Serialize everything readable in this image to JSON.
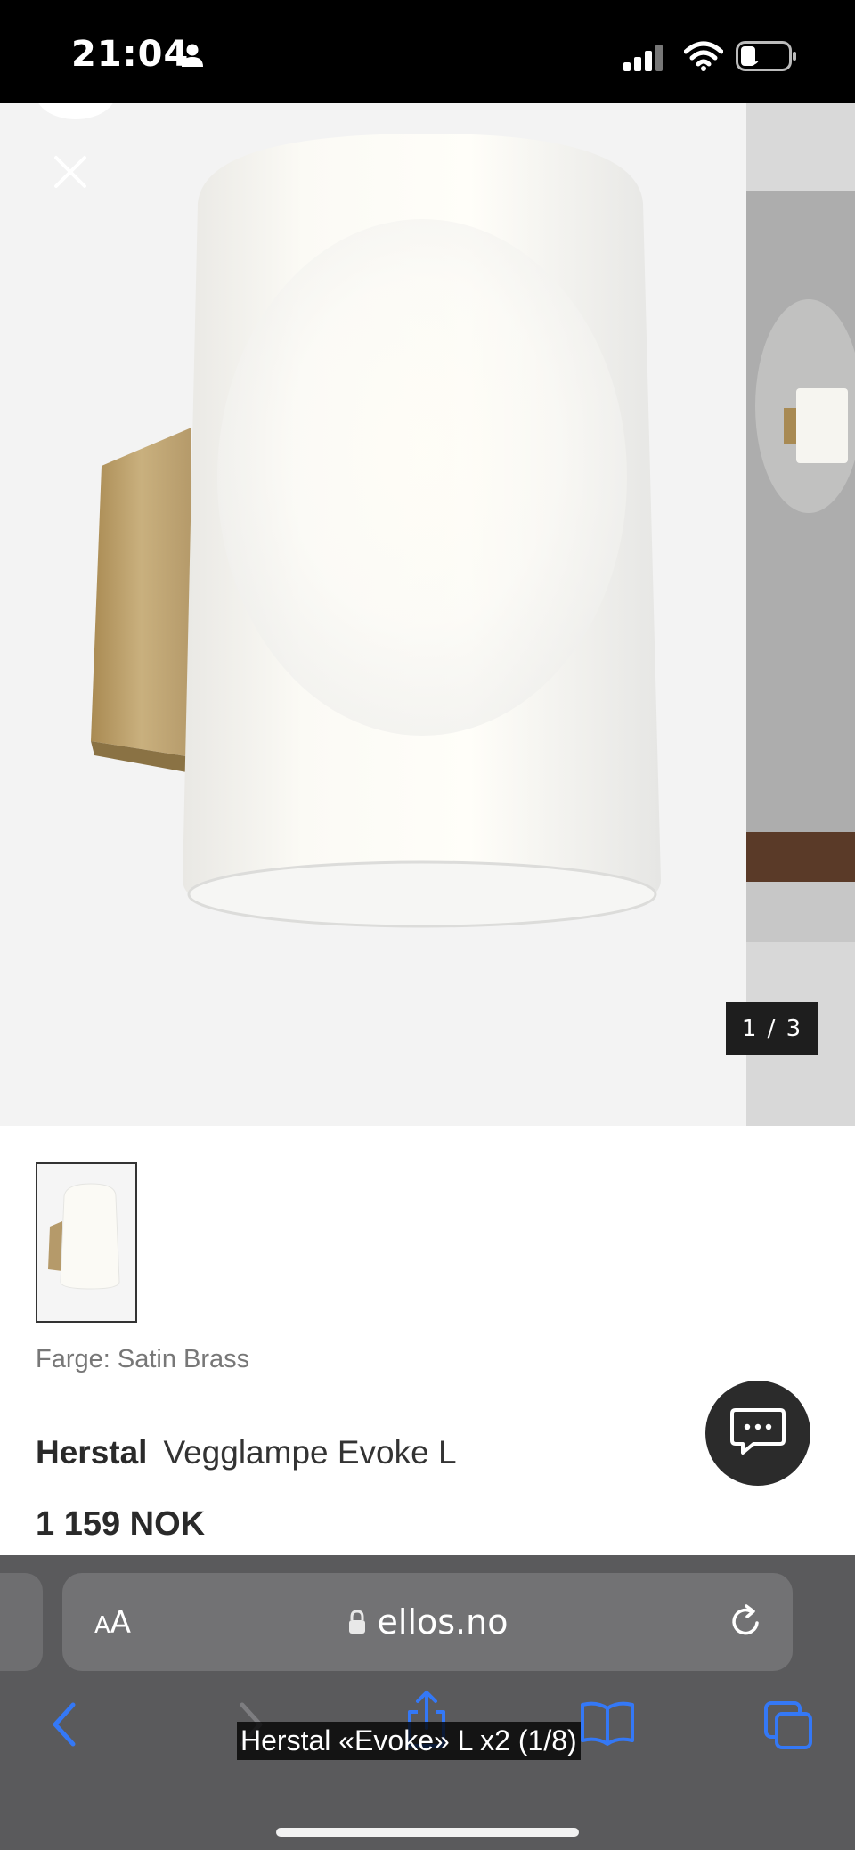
{
  "status_bar": {
    "time": "21:04",
    "icons": [
      "person-icon",
      "signal-icon",
      "wifi-icon",
      "battery-icon"
    ]
  },
  "gallery": {
    "counter": "1 / 3",
    "close_icon": "close-icon"
  },
  "product": {
    "color_label": "Farge: Satin Brass",
    "brand": "Herstal",
    "name": "Vegglampe Evoke L",
    "price": "1 159 NOK"
  },
  "browser": {
    "text_size_small": "A",
    "text_size_large": "A",
    "url": "ellos.no",
    "toolbar_icons": [
      "back-icon",
      "forward-icon",
      "share-icon",
      "bookmarks-icon",
      "tabs-icon"
    ]
  },
  "caption": "Herstal «Evoke» L x2 (1/8)",
  "colors": {
    "accent": "#3478f6",
    "browser_bg": "#5a5a5c",
    "address_bar_bg": "#727274",
    "brass": "#b59a6a"
  }
}
